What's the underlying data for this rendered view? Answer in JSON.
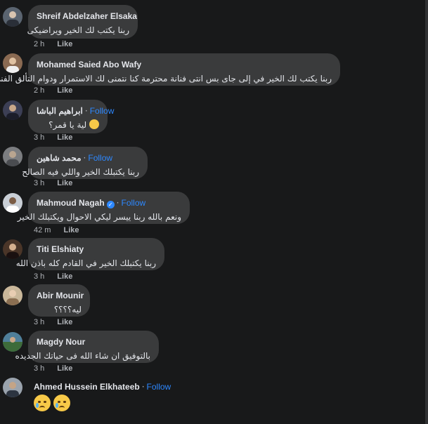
{
  "comments": [
    {
      "name": "Shreif Abdelzaher Elsaka",
      "text": "ربنا يكتب لك الخير ويراضيكى",
      "time": "2 h",
      "like": "Like",
      "avatar_color": "#5a6470"
    },
    {
      "name": "Mohamed Saied Abo Wafy",
      "text": "ربنا يكتب لك الخير في إلى جاى بس انتى فنانة محترمة كنا نتمنى لك الاستمرار ودوام التألق الفنى",
      "time": "2 h",
      "like": "Like",
      "avatar_color": "#8a6a52"
    },
    {
      "name": "ابراهيم الباشا",
      "follow": "Follow",
      "text": "لية يا قمر؟",
      "time": "3 h",
      "like": "Like",
      "avatar_color": "#3c3f55"
    },
    {
      "name": "محمد شاهين",
      "follow": "Follow",
      "text": "ربنا يكتبلك الخير واللي فيه الصالح",
      "time": "3 h",
      "like": "Like",
      "avatar_color": "#7b7d80"
    },
    {
      "name": "Mahmoud Nagah",
      "follow": "Follow",
      "verified": true,
      "text": "ونعم بالله ربنا ييسر ليكي الاحوال ويكتبلك الخير",
      "time": "42 m",
      "like": "Like",
      "avatar_color": "#c9cfd6"
    },
    {
      "name": "Titi Elshiaty",
      "text": "ربنا يكتبلك الخير في القادم كله باذن الله",
      "time": "3 h",
      "like": "Like",
      "avatar_color": "#4a3528"
    },
    {
      "name": "Abir Mounir",
      "text": "ليه؟؟؟؟",
      "time": "3 h",
      "like": "Like",
      "avatar_color": "#c9b79a"
    },
    {
      "name": "Magdy Nour",
      "text": "بالتوفيق ان شاء الله فى حياتك الجديده",
      "time": "3 h",
      "like": "Like",
      "avatar_color": "#4f7f9a"
    },
    {
      "name": "Ahmed Hussein Elkhateeb",
      "follow": "Follow",
      "emoji_count": 2,
      "avatar_color": "#9aa3ad"
    }
  ]
}
